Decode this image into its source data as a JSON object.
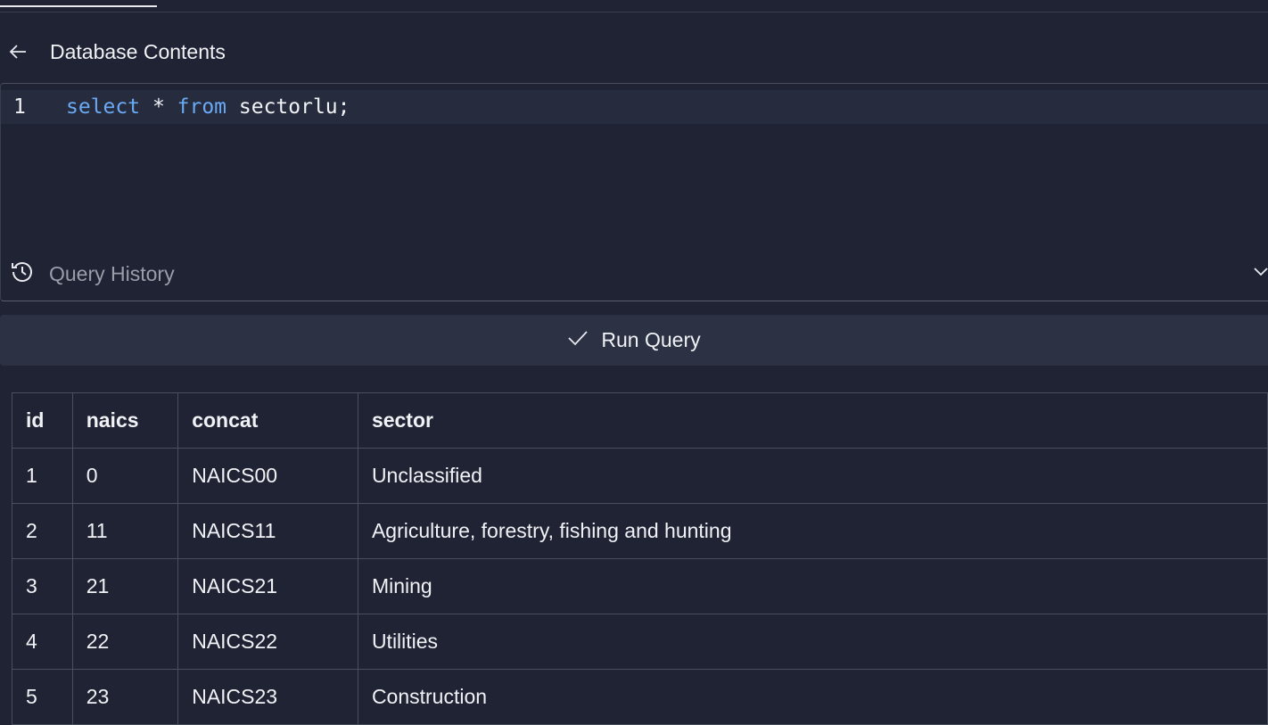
{
  "header": {
    "title": "Database Contents"
  },
  "editor": {
    "line_number": "1",
    "tokens": [
      {
        "text": "select",
        "kw": true
      },
      {
        "text": " * ",
        "kw": false
      },
      {
        "text": "from",
        "kw": true
      },
      {
        "text": " sectorlu;",
        "kw": false
      }
    ]
  },
  "query_history": {
    "label": "Query History"
  },
  "run_button": {
    "label": "Run Query"
  },
  "table": {
    "columns": [
      "id",
      "naics",
      "concat",
      "sector"
    ],
    "rows": [
      [
        "1",
        "0",
        "NAICS00",
        "Unclassified"
      ],
      [
        "2",
        "11",
        "NAICS11",
        "Agriculture, forestry, fishing and hunting"
      ],
      [
        "3",
        "21",
        "NAICS21",
        "Mining"
      ],
      [
        "4",
        "22",
        "NAICS22",
        "Utilities"
      ],
      [
        "5",
        "23",
        "NAICS23",
        "Construction"
      ]
    ]
  }
}
